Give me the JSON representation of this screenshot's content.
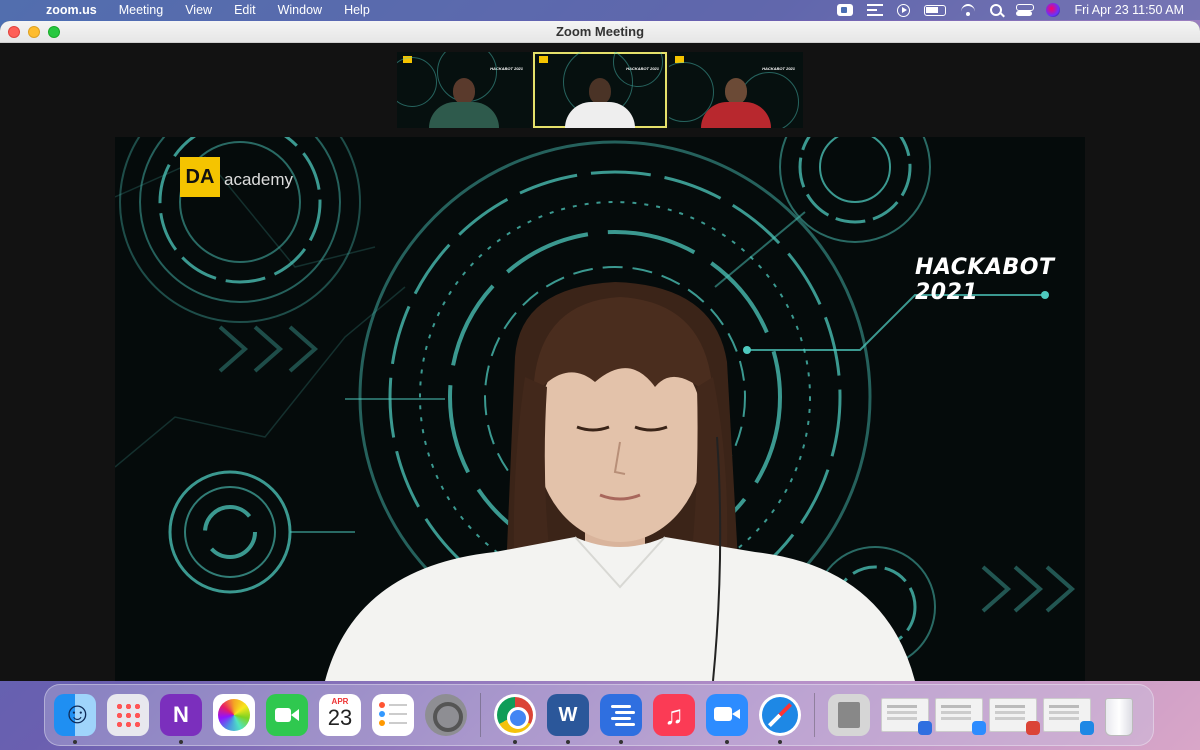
{
  "menubar": {
    "app_name": "zoom.us",
    "items": [
      "Meeting",
      "View",
      "Edit",
      "Window",
      "Help"
    ],
    "status_icons": [
      "zoom-icon",
      "list-icon",
      "play-icon",
      "battery-icon",
      "wifi-icon",
      "search-icon",
      "control-center-icon",
      "siri-icon"
    ],
    "clock": "Fri Apr 23  11:50 AM"
  },
  "window": {
    "title": "Zoom Meeting"
  },
  "meeting": {
    "participants": [
      {
        "label": "participant-1",
        "active": false
      },
      {
        "label": "participant-2",
        "active": true
      },
      {
        "label": "participant-3",
        "active": false
      }
    ],
    "background": {
      "logo_badge": "DA",
      "logo_text": "academy",
      "event_title": "HACKABOT 2021"
    },
    "colors": {
      "accent_line": "#4ec9be",
      "active_border": "#e5e06a",
      "logo_yellow": "#f5c400"
    }
  },
  "dock": {
    "calendar_month": "APR",
    "calendar_day": "23",
    "onenote_letter": "N",
    "word_letter": "W",
    "music_glyph": "♫"
  }
}
